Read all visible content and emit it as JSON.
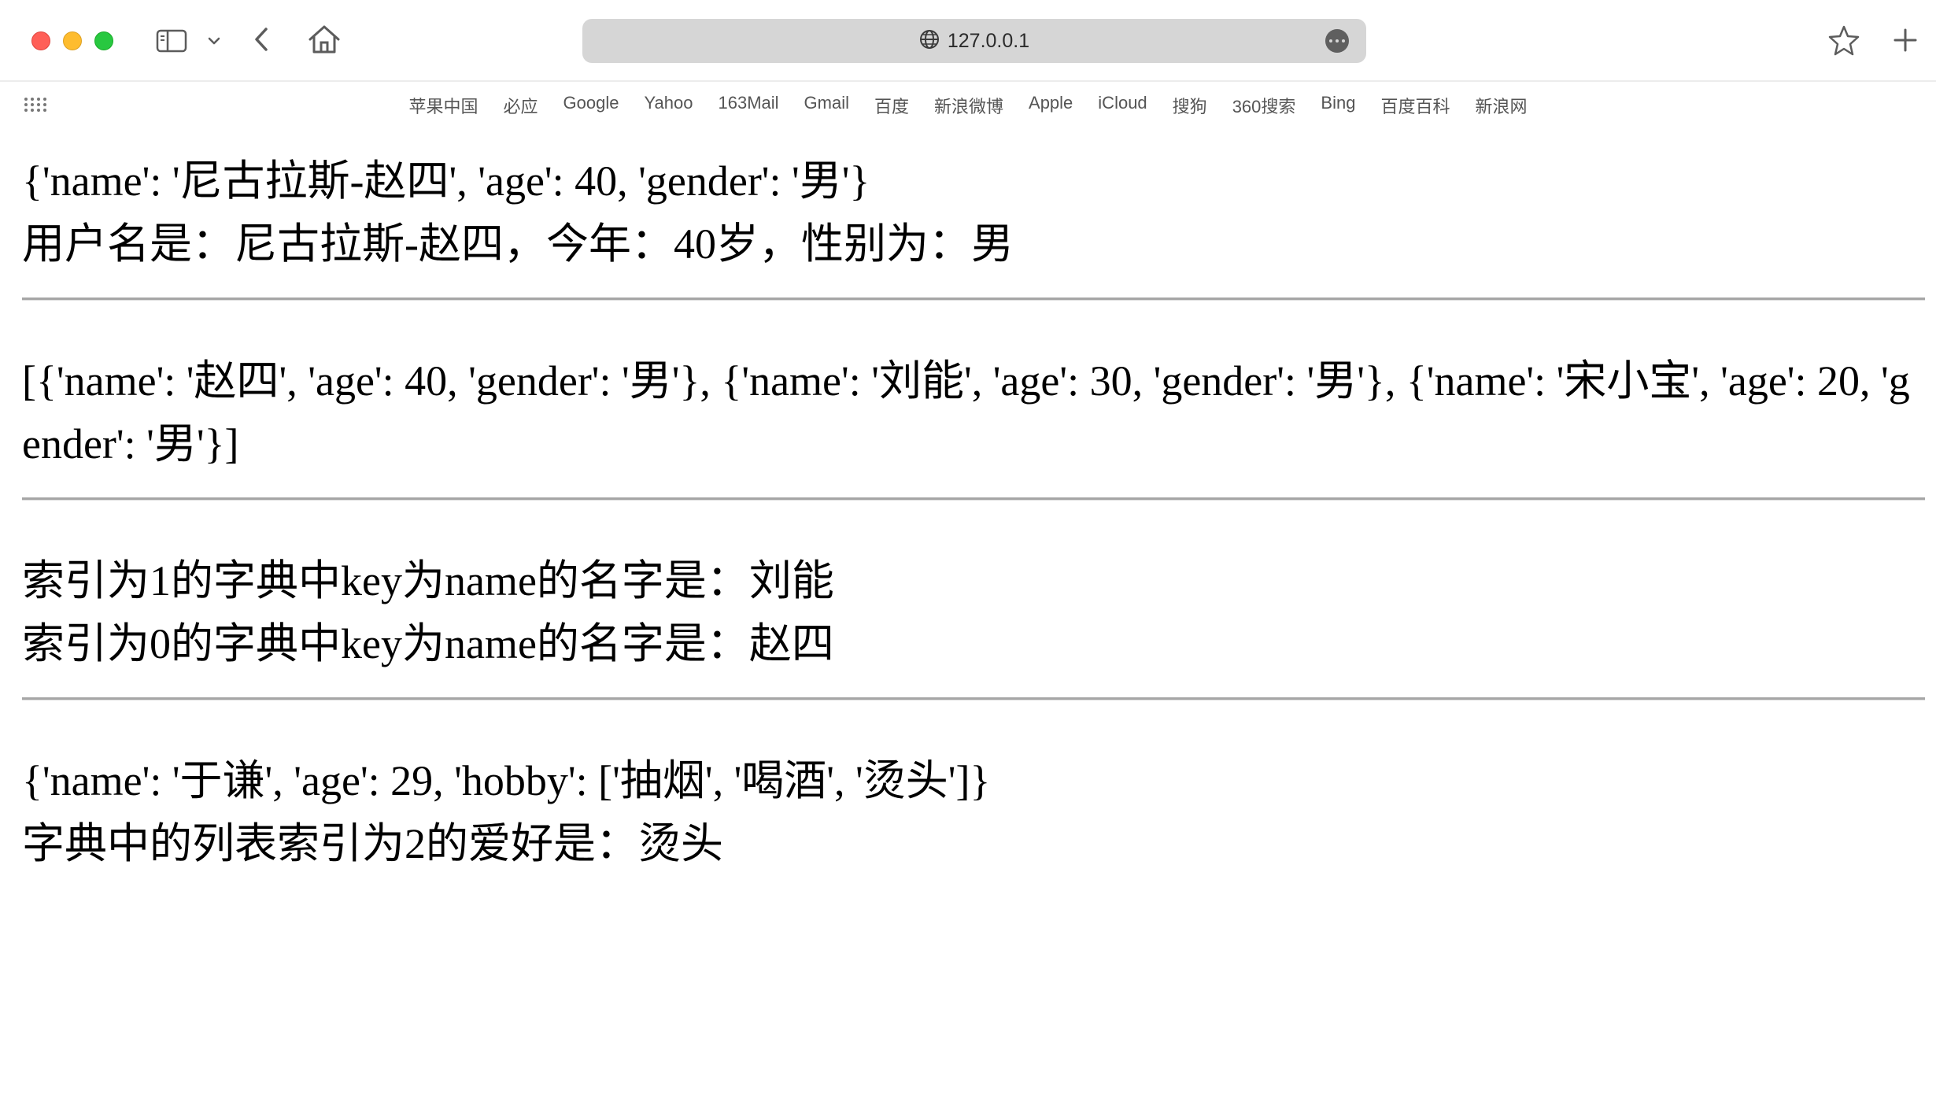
{
  "browser": {
    "url": "127.0.0.1",
    "icons": {
      "sidebar": "sidebar-icon",
      "chevron": "chevron-down-icon",
      "back": "back-arrow-icon",
      "home": "home-icon",
      "globe": "globe-icon",
      "more": "more-icon",
      "star": "star-icon",
      "plus": "plus-icon",
      "grid": "grid-icon"
    },
    "favorites": [
      "苹果中国",
      "必应",
      "Google",
      "Yahoo",
      "163Mail",
      "Gmail",
      "百度",
      "新浪微博",
      "Apple",
      "iCloud",
      "搜狗",
      "360搜索",
      "Bing",
      "百度百科",
      "新浪网"
    ]
  },
  "content": {
    "block1": {
      "dict": "{'name': '尼古拉斯-赵四', 'age': 40, 'gender': '男'}",
      "sentence": "用户名是：尼古拉斯-赵四，今年：40岁，性别为：男"
    },
    "block2": {
      "list": "[{'name': '赵四', 'age': 40, 'gender': '男'}, {'name': '刘能', 'age': 30, 'gender': '男'}, {'name': '宋小宝', 'age': 20, 'gender': '男'}]"
    },
    "block3": {
      "line1": "索引为1的字典中key为name的名字是：刘能",
      "line2": "索引为0的字典中key为name的名字是：赵四"
    },
    "block4": {
      "dict": "{'name': '于谦', 'age': 29, 'hobby': ['抽烟', '喝酒', '烫头']}",
      "sentence": "字典中的列表索引为2的爱好是：烫头"
    }
  }
}
